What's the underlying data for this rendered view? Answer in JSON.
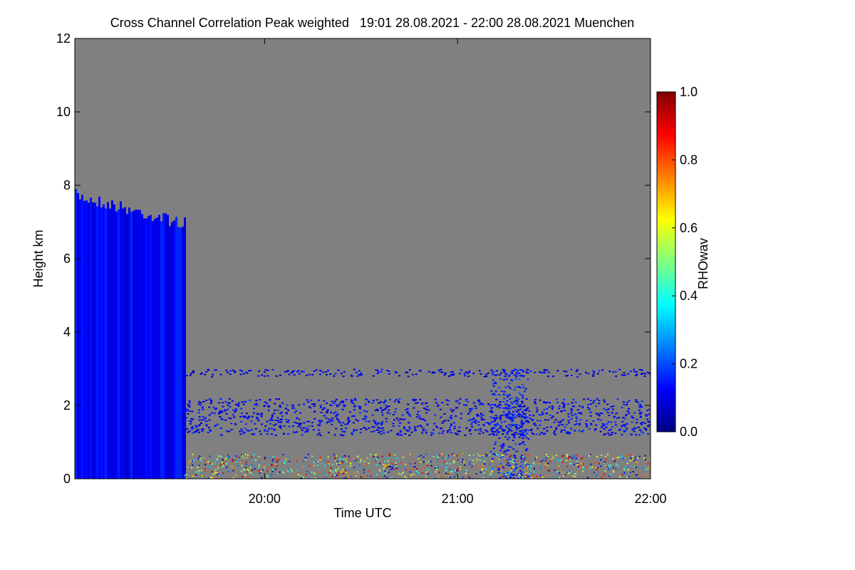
{
  "chart_data": {
    "type": "heatmap",
    "title": "Cross Channel Correlation Peak weighted   19:01 28.08.2021 - 22:00 28.08.2021 Muenchen",
    "xlabel": "Time UTC",
    "ylabel": "Height km",
    "xlim": [
      "19:01",
      "22:00"
    ],
    "ylim": [
      0,
      12
    ],
    "x_ticks": [
      "20:00",
      "21:00",
      "22:00"
    ],
    "y_ticks": [
      "0",
      "2",
      "4",
      "6",
      "8",
      "10",
      "12"
    ],
    "colorbar": {
      "label": "RHOwav",
      "range": [
        0.0,
        1.0
      ],
      "ticks": [
        "0.0",
        "0.2",
        "0.4",
        "0.6",
        "0.8",
        "1.0"
      ],
      "colormap": "jet"
    },
    "background_color": "#808080",
    "features": [
      {
        "description": "Dense low-correlation cloud layer",
        "x_start": "19:01",
        "x_end": "19:35",
        "y_min": 0,
        "y_max": 7.9,
        "value": 0.12
      },
      {
        "description": "Scattered layer near 1.6 km",
        "x_start": "19:35",
        "x_end": "22:00",
        "y_min": 1.2,
        "y_max": 2.2,
        "value": 0.12
      },
      {
        "description": "Thin layer near 2.9 km",
        "x_start": "19:35",
        "x_end": "22:00",
        "y_min": 2.8,
        "y_max": 3.0,
        "value": 0.1
      },
      {
        "description": "Convective plume",
        "x_start": "21:10",
        "x_end": "21:22",
        "y_min": 0,
        "y_max": 3.0,
        "value": 0.15
      },
      {
        "description": "Noisy high-correlation boundary layer",
        "x_start": "19:35",
        "x_end": "22:00",
        "y_min": 0,
        "y_max": 0.7,
        "value": 0.6
      }
    ]
  }
}
